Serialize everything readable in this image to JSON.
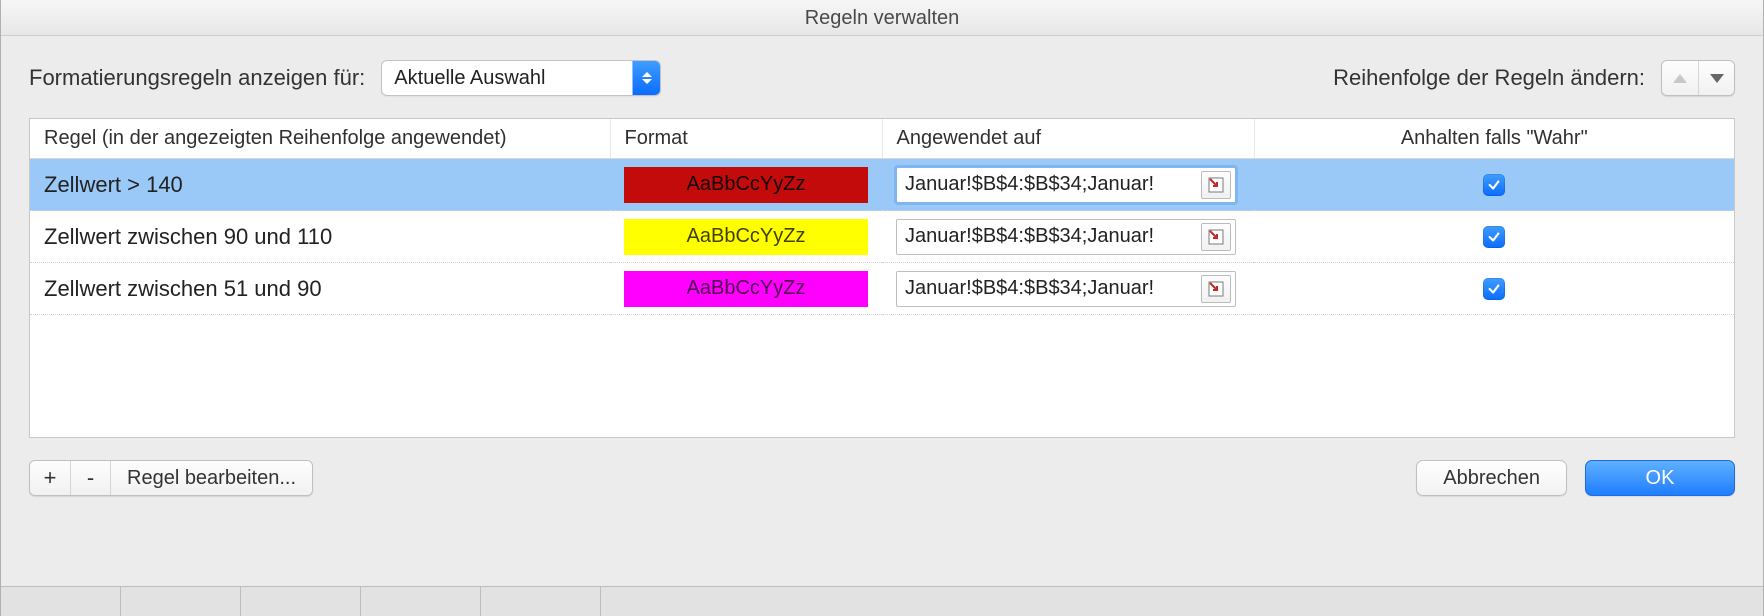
{
  "window_title": "Regeln verwalten",
  "toolbar": {
    "show_rules_for_label": "Formatierungsregeln anzeigen für:",
    "scope_value": "Aktuelle Auswahl",
    "reorder_label": "Reihenfolge der Regeln ändern:"
  },
  "columns": {
    "rule": "Regel (in der angezeigten Reihenfolge angewendet)",
    "format": "Format",
    "applied": "Angewendet auf",
    "stop": "Anhalten falls \"Wahr\""
  },
  "format_sample": "AaBbCcYyZz",
  "rules": [
    {
      "name": "Zellwert > 140",
      "format_color": "red",
      "applied_to": "Januar!$B$4:$B$34;Januar!",
      "stop_if_true": true,
      "selected": true
    },
    {
      "name": "Zellwert zwischen 90 und 110",
      "format_color": "yellow",
      "applied_to": "Januar!$B$4:$B$34;Januar!",
      "stop_if_true": true,
      "selected": false
    },
    {
      "name": "Zellwert zwischen 51 und 90",
      "format_color": "magenta",
      "applied_to": "Januar!$B$4:$B$34;Januar!",
      "stop_if_true": true,
      "selected": false
    }
  ],
  "buttons": {
    "add": "+",
    "remove": "-",
    "edit": "Regel bearbeiten...",
    "cancel": "Abbrechen",
    "ok": "OK"
  }
}
